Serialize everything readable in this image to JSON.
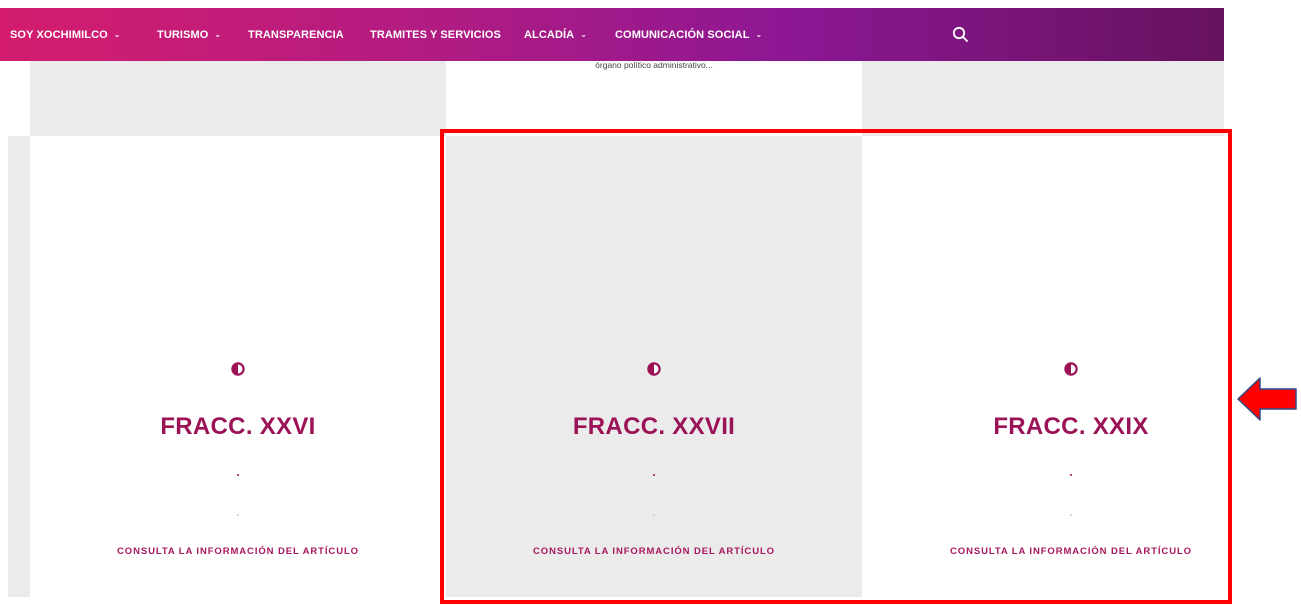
{
  "nav": {
    "items": [
      {
        "label": "SOY XOCHIMILCO",
        "has_dropdown": true
      },
      {
        "label": "TURISMO",
        "has_dropdown": true
      },
      {
        "label": "TRANSPARENCIA",
        "has_dropdown": false
      },
      {
        "label": "TRAMITES Y SERVICIOS",
        "has_dropdown": false
      },
      {
        "label": "ALCADÍA",
        "has_dropdown": true
      },
      {
        "label": "COMUNICACIÓN SOCIAL",
        "has_dropdown": true
      }
    ],
    "chevron_glyph": "⌄",
    "search_icon": "search-icon",
    "gradient_colors": [
      "#d41d6e",
      "#8c1794",
      "#66125e"
    ]
  },
  "previous_row": {
    "snippet": "órgano político administrativo..."
  },
  "cards": [
    {
      "icon": "half-circle-icon",
      "title": "FRACC. XXVI",
      "separator": ".",
      "link": "CONSULTA LA INFORMACIÓN DEL ARTÍCULO"
    },
    {
      "icon": "half-circle-icon",
      "title": "FRACC. XXVII",
      "separator": ".",
      "link": "CONSULTA LA INFORMACIÓN DEL ARTÍCULO"
    },
    {
      "icon": "half-circle-icon",
      "title": "FRACC. XXIX",
      "separator": ".",
      "link": "CONSULTA LA INFORMACIÓN DEL ARTÍCULO"
    }
  ],
  "colors": {
    "accent": "#9c1257",
    "highlight": "#ff0000",
    "card_gray": "#ebebeb"
  },
  "annotation": {
    "arrow_icon": "left-arrow-icon",
    "arrow_fill": "#ff0000",
    "arrow_stroke": "#2f4b8a"
  }
}
